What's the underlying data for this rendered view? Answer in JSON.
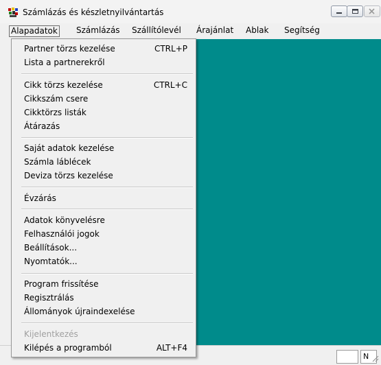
{
  "window": {
    "title": "Számlázás és készletnyilvántartás"
  },
  "menubar": {
    "items": [
      "Alapadatok",
      "Számlázás",
      "Szállítólevél",
      "Árajánlat",
      "Ablak",
      "Segítség"
    ]
  },
  "dropdown": {
    "items": [
      {
        "label": "Partner törzs kezelése",
        "shortcut": "CTRL+P"
      },
      {
        "label": "Lista a partnerekről"
      },
      {
        "label": "Cikk törzs kezelése",
        "shortcut": "CTRL+C"
      },
      {
        "label": "Cikkszám csere"
      },
      {
        "label": "Cikktörzs  listák"
      },
      {
        "label": "Átárazás"
      },
      {
        "label": "Saját adatok kezelése"
      },
      {
        "label": "Számla láblécek"
      },
      {
        "label": "Deviza törzs kezelése"
      },
      {
        "label": "Évzárás"
      },
      {
        "label": "Adatok könyvelésre"
      },
      {
        "label": "Felhasználói jogok"
      },
      {
        "label": "Beállítások..."
      },
      {
        "label": "Nyomtatók..."
      },
      {
        "label": "Program frissítése"
      },
      {
        "label": "Regisztrálás"
      },
      {
        "label": "Állományok újraindexelése"
      },
      {
        "label": "Kijelentkezés",
        "disabled": true
      },
      {
        "label": "Kilépés a programból",
        "shortcut": "ALT+F4"
      }
    ]
  },
  "statusbar": {
    "indicator": "N"
  },
  "colors": {
    "client_background": "#008b8b",
    "menu_background": "#f0f0f0"
  }
}
